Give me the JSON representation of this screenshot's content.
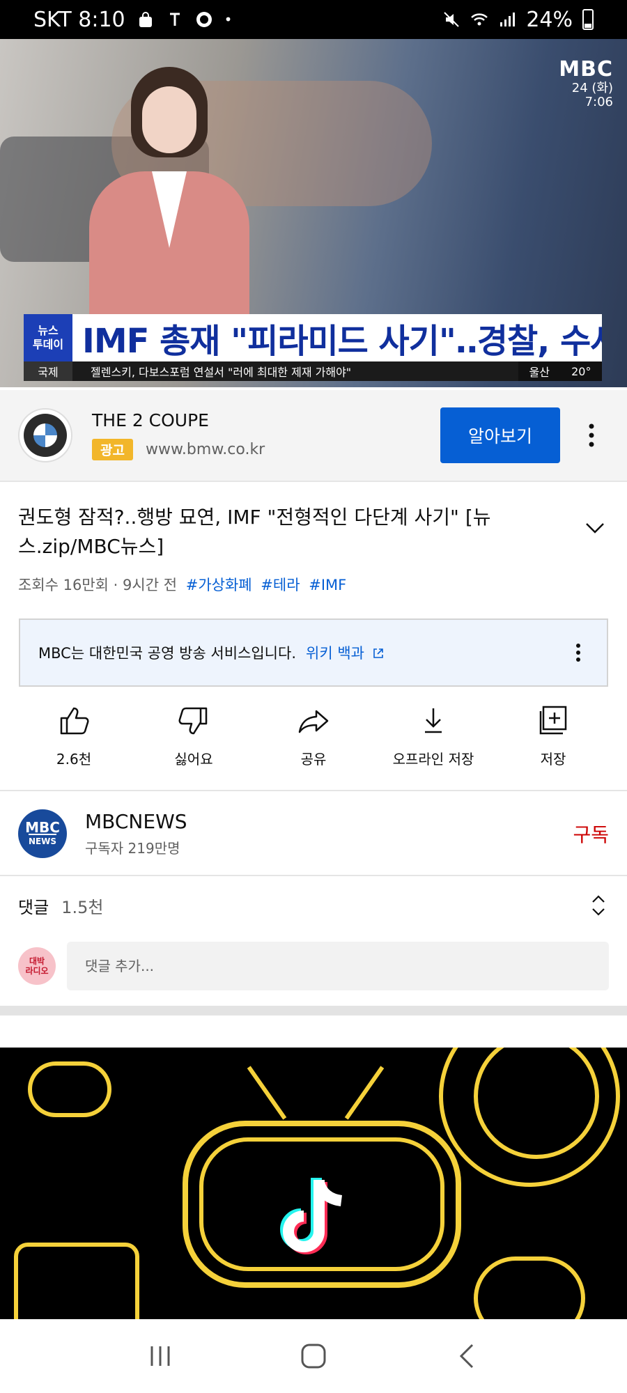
{
  "status_bar": {
    "carrier_time": "SKT 8:10",
    "battery": "24%"
  },
  "video": {
    "channel_logo": "MBC",
    "date": "24 (화)",
    "time": "7:06",
    "lower_third_tag_line1": "뉴스",
    "lower_third_tag_line2": "투데이",
    "headline": "IMF 총재 \"피라미드 사기\"‥경찰, 수사 착수",
    "ticker_category": "국제",
    "ticker_text": "젤렌스키, 다보스포럼 연설서 \"러에 최대한 제재 가해야\"",
    "weather_city": "울산",
    "weather_temp": "20°",
    "progress_fraction": 0.02
  },
  "ad": {
    "title": "THE 2 COUPE",
    "badge": "광고",
    "url": "www.bmw.co.kr",
    "cta": "알아보기",
    "logo_icon": "bmw-logo"
  },
  "video_info": {
    "title": "권도형 잠적?..행방 묘연, IMF \"전형적인 다단계 사기\" [뉴스.zip/MBC뉴스]",
    "views_time": "조회수 16만회 · 9시간 전",
    "hashtags": [
      "#가상화폐",
      "#테라",
      "#IMF"
    ]
  },
  "info_panel": {
    "text": "MBC는 대한민국 공영 방송 서비스입니다.",
    "link": "위키 백과"
  },
  "actions": [
    {
      "label": "2.6천",
      "icon": "thumbs-up-icon"
    },
    {
      "label": "싫어요",
      "icon": "thumbs-down-icon"
    },
    {
      "label": "공유",
      "icon": "share-icon"
    },
    {
      "label": "오프라인 저장",
      "icon": "download-icon"
    },
    {
      "label": "저장",
      "icon": "playlist-add-icon"
    }
  ],
  "channel": {
    "avatar_line1": "MBC",
    "avatar_line2": "NEWS",
    "name": "MBCNEWS",
    "subscribers": "구독자 219만명",
    "subscribe_label": "구독"
  },
  "comments": {
    "label": "댓글",
    "count": "1.5천",
    "avatar_line1": "대박",
    "avatar_line2": "라디오",
    "placeholder": "댓글 추가..."
  },
  "colors": {
    "accent_blue": "#065fd4",
    "subscribe_red": "#cc0000",
    "ad_badge": "#f2b62a",
    "headline_blue": "#102f9d",
    "thumb_yellow": "#f5d13a"
  }
}
